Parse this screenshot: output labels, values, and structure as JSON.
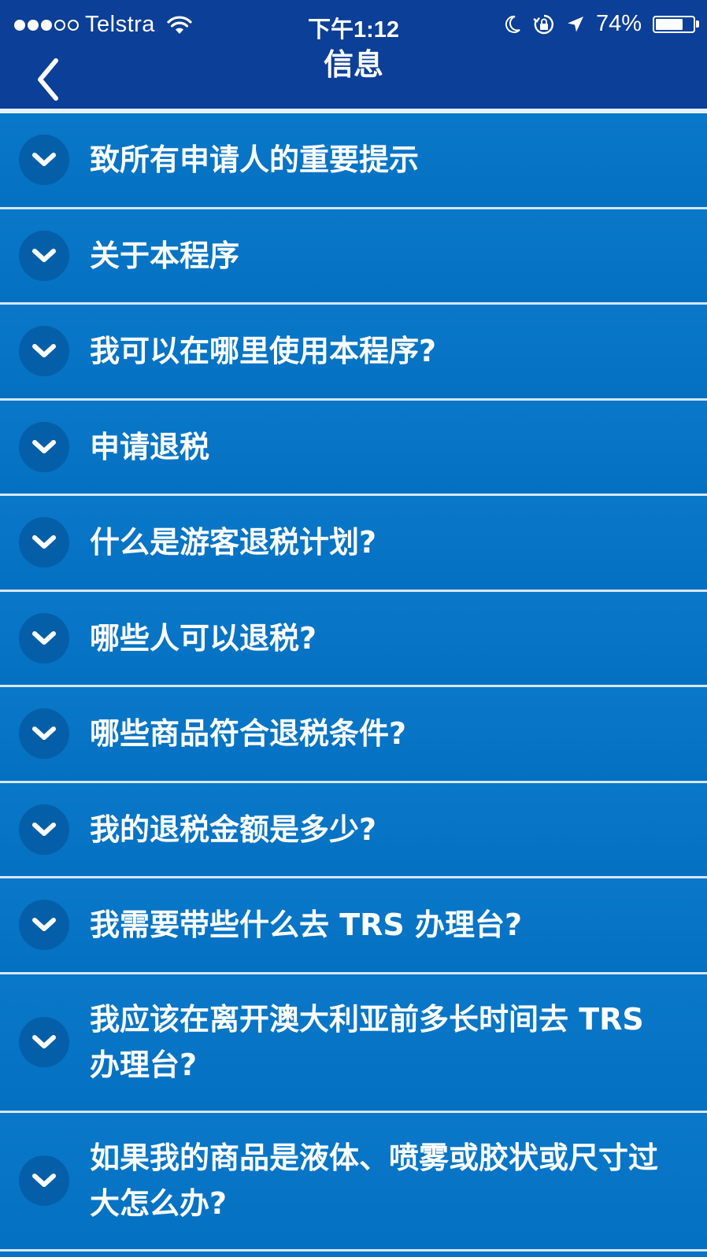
{
  "status_bar": {
    "signal_dots_filled": 3,
    "signal_dots_empty": 2,
    "carrier": "Telstra",
    "time": "下午1:12",
    "battery_percent": "74%",
    "battery_level": 0.74,
    "icons": [
      "wifi-icon",
      "moon-icon",
      "orientation-lock-icon",
      "location-arrow-icon",
      "battery-icon"
    ]
  },
  "nav": {
    "title": "信息",
    "back_icon": "chevron-left-icon"
  },
  "faq": {
    "items": [
      {
        "label": "致所有申请人的重要提示"
      },
      {
        "label": "关于本程序"
      },
      {
        "label": "我可以在哪里使用本程序?"
      },
      {
        "label": "申请退税"
      },
      {
        "label": "什么是游客退税计划?"
      },
      {
        "label": "哪些人可以退税?"
      },
      {
        "label": "哪些商品符合退税条件?"
      },
      {
        "label": "我的退税金额是多少?"
      },
      {
        "label": "我需要带些什么去 TRS 办理台?"
      },
      {
        "label": "我应该在离开澳大利亚前多长时间去 TRS 办理台?"
      },
      {
        "label": "如果我的商品是液体、喷雾或胶状或尺寸过大怎么办?"
      }
    ],
    "expand_icon": "chevron-down-icon"
  },
  "colors": {
    "bar_background": "#0b3f98",
    "list_background": "#0672c4",
    "separator": "#d7e7f7",
    "chevron_circle": "#055fa8",
    "text": "#ffffff"
  }
}
